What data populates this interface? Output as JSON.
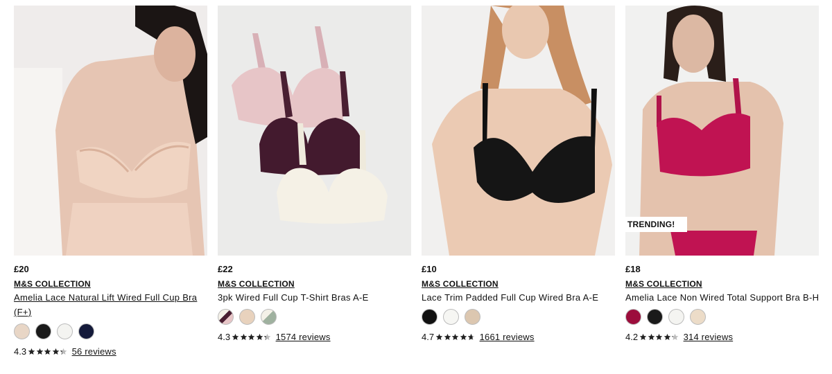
{
  "products": [
    {
      "price": "£20",
      "brand": "M&S COLLECTION",
      "title": "Amelia Lace Natural Lift Wired Full Cup Bra (F+)",
      "colors": [
        "#e8d6c6",
        "#1a1a1a",
        "#f4f4f1",
        "#141a3a"
      ],
      "rating": "4.3",
      "reviews": "56 reviews",
      "badge": ""
    },
    {
      "price": "£22",
      "brand": "M&S COLLECTION",
      "title": "3pk Wired Full Cup T-Shirt Bras A-E",
      "colors": [
        "mix-plum",
        "#e8d2bd",
        "mix-sage"
      ],
      "rating": "4.3",
      "reviews": "1574 reviews",
      "badge": ""
    },
    {
      "price": "£10",
      "brand": "M&S COLLECTION",
      "title": "Lace Trim Padded Full Cup Wired Bra A-E",
      "colors": [
        "#111111",
        "#f6f6f3",
        "#dcc7b0"
      ],
      "rating": "4.7",
      "reviews": "1661 reviews",
      "badge": ""
    },
    {
      "price": "£18",
      "brand": "M&S COLLECTION",
      "title": "Amelia Lace Non Wired Total Support Bra B-H",
      "colors": [
        "#9c0d3c",
        "#1a1a1a",
        "#f4f4f1",
        "#ecdcc8"
      ],
      "rating": "4.2",
      "reviews": "314 reviews",
      "badge": "TRENDING!"
    }
  ]
}
